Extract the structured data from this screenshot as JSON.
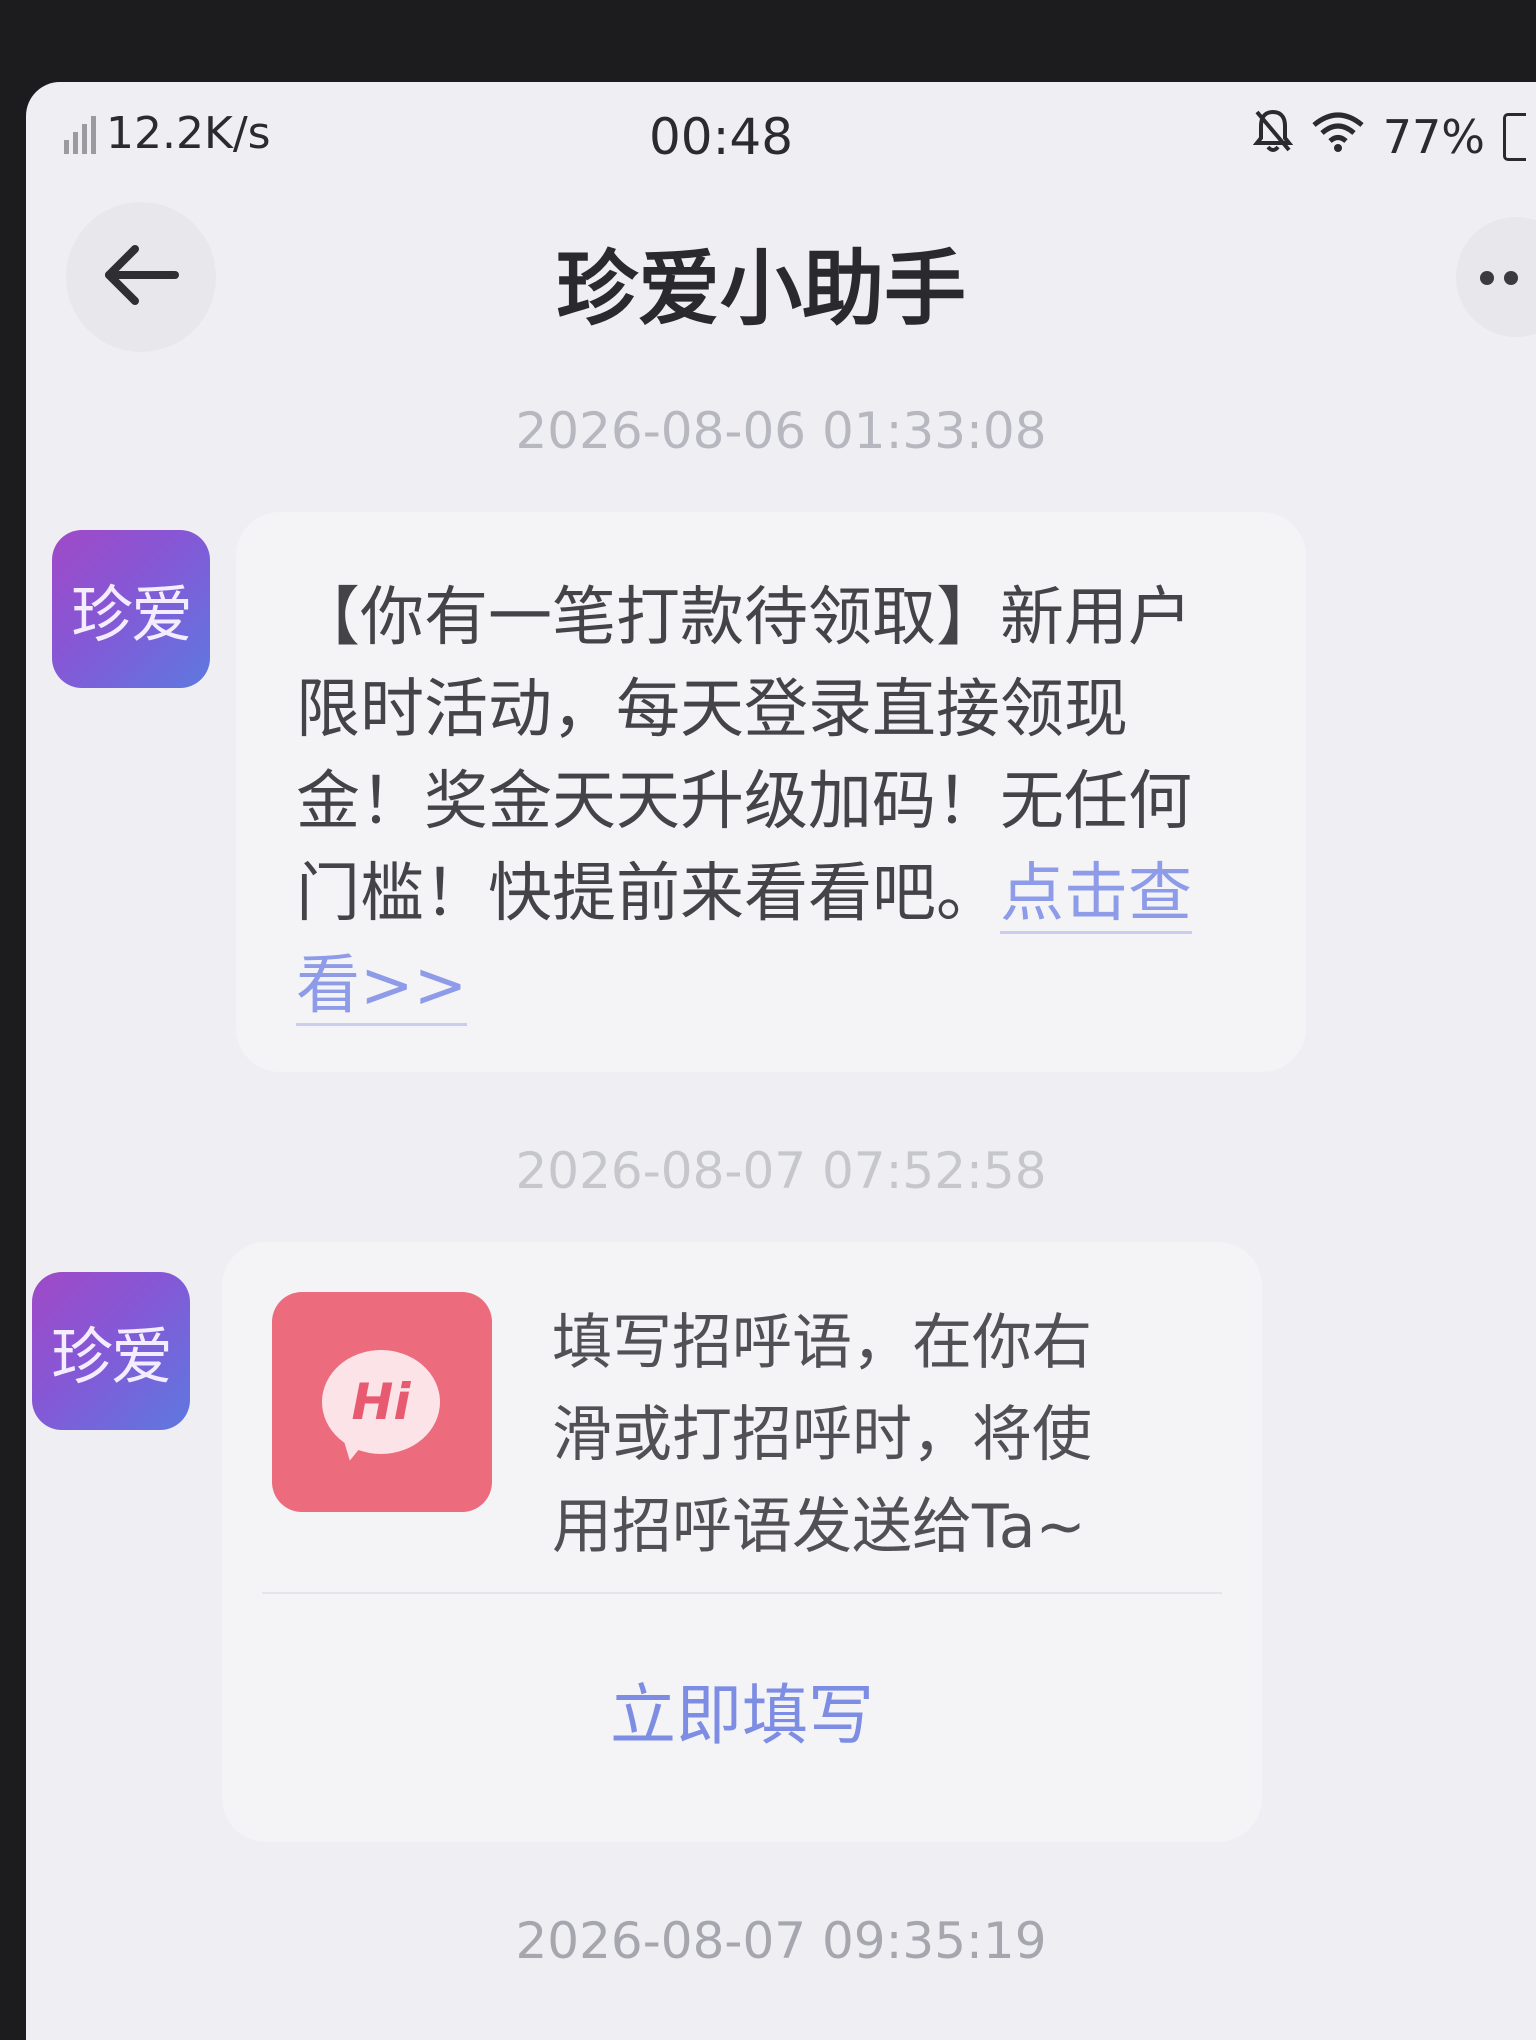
{
  "status_bar": {
    "network_speed": "12.2K/s",
    "time": "00:48",
    "battery": "77%"
  },
  "header": {
    "title": "珍爱小助手",
    "back_icon": "arrow-left-icon",
    "more_icon": "more-dots-icon"
  },
  "messages": [
    {
      "timestamp": "2026-08-06 01:33:08",
      "avatar_label": "珍爱",
      "text": "【你有一笔打款待领取】新用户限时活动，每天登录直接领现金！奖金天天升级加码！无任何门槛！快提前来看看吧。",
      "link_text": "点击查看>>"
    },
    {
      "timestamp": "2026-08-07 07:52:58",
      "avatar_label": "珍爱",
      "card_icon_label": "Hi",
      "card_text": "填写招呼语，在你右滑或打招呼时，将使用招呼语发送给Ta~",
      "action_label": "立即填写"
    }
  ],
  "last_timestamp": "2026-08-07 09:35:19",
  "colors": {
    "avatar_gradient_start": "#a049c6",
    "avatar_gradient_end": "#5d79e0",
    "link": "#8e9be8",
    "hi_icon_bg": "#ec6b7d"
  }
}
